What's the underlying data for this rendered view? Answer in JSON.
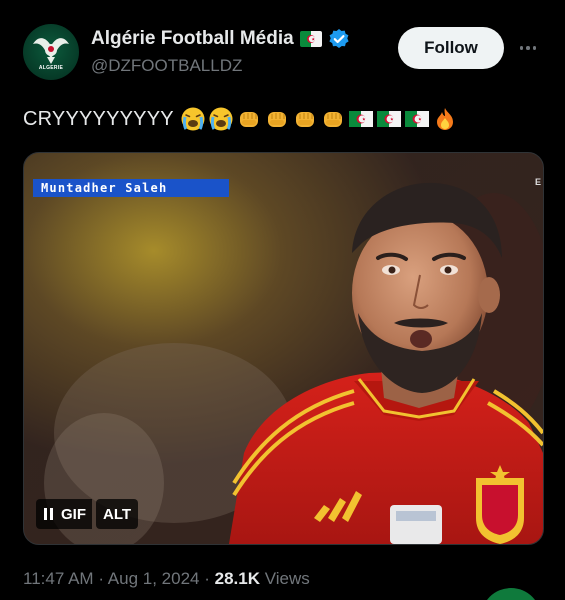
{
  "author": {
    "display_name": "Algérie Football Média",
    "handle": "@DZFOOTBALLDZ",
    "avatar_text": "ALGERIE",
    "avatar_icon": "eagle-logo-icon",
    "verified_icon": "verified-badge-icon",
    "flag_icon": "algeria-flag-icon"
  },
  "actions": {
    "follow_label": "Follow",
    "more_icon": "more-options-icon"
  },
  "tweet": {
    "text": "CRYYYYYYYYY",
    "emojis": [
      "crying-face",
      "crying-face",
      "fist-bump",
      "fist-bump",
      "fist-bump",
      "fist-bump",
      "algeria-flag",
      "algeria-flag",
      "algeria-flag",
      "fire"
    ]
  },
  "media": {
    "type": "GIF",
    "caption_name": "Muntadher Saleh",
    "corner_mark": "E",
    "controls": {
      "gif_label": "GIF",
      "alt_label": "ALT"
    }
  },
  "meta": {
    "time": "11:47 AM",
    "separator": "·",
    "date": "Aug 1, 2024",
    "views_count": "28.1K",
    "views_label": "Views"
  },
  "colors": {
    "background": "#000000",
    "text_primary": "#e7e9ea",
    "text_secondary": "#71767b",
    "verified_blue": "#1d9bf0",
    "follow_bg": "#eff3f4",
    "caption_blue": "#1a53c9"
  }
}
